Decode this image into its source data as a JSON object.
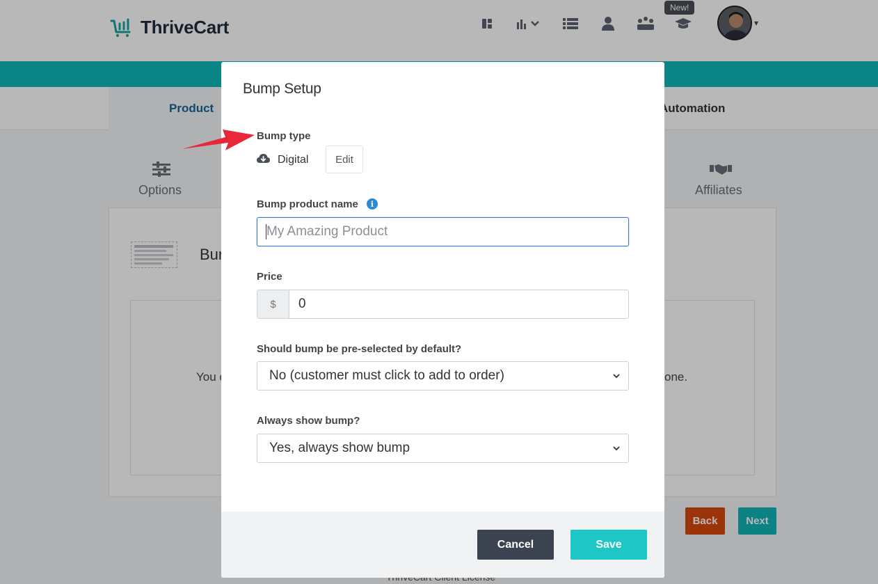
{
  "app": {
    "brand": "ThriveCart",
    "new_badge": "New!",
    "nav_icons": [
      "dashboard-icon",
      "analytics-icon",
      "list-icon",
      "user-icon",
      "affiliates-icon",
      "learn-icon"
    ]
  },
  "tabs": {
    "product": "Product",
    "automation": "Automation"
  },
  "subnav": {
    "options": "Options",
    "affiliates": "Affiliates"
  },
  "panel": {
    "title_fragment": "Bum",
    "text_left_fragment": "You c",
    "text_right_fragment": "one."
  },
  "page_buttons": {
    "back": "Back",
    "next": "Next"
  },
  "footer": {
    "license": "ThriveCart Client License"
  },
  "modal": {
    "title": "Bump Setup",
    "bump_type_label": "Bump type",
    "bump_type_value": "Digital",
    "edit_label": "Edit",
    "product_name_label": "Bump product name",
    "product_name_placeholder": "My Amazing Product",
    "price_label": "Price",
    "price_currency": "$",
    "price_value": "0",
    "preselect_label": "Should bump be pre-selected by default?",
    "preselect_value": "No (customer must click to add to order)",
    "always_show_label": "Always show bump?",
    "always_show_value": "Yes, always show bump",
    "cancel_label": "Cancel",
    "save_label": "Save"
  },
  "colors": {
    "brand_teal": "#13b5b5",
    "tab_blue": "#14679a",
    "back_orange": "#d9480f",
    "cancel_dark": "#3b4350",
    "save_teal": "#1fc6c6",
    "annotation_red": "#e8283a",
    "info_blue": "#2a8ad6"
  }
}
